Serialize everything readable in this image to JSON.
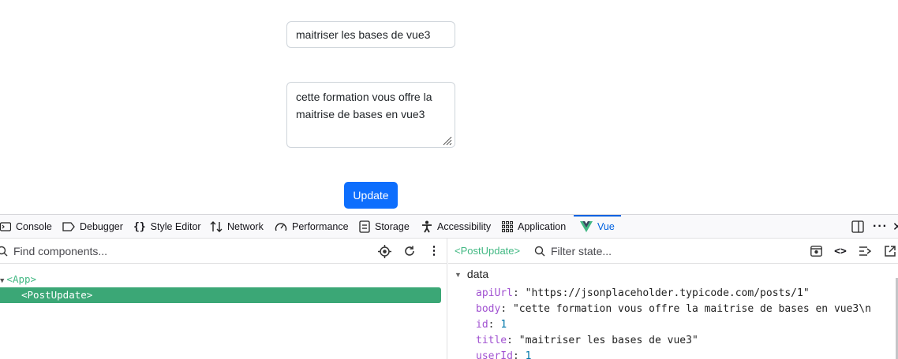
{
  "form": {
    "title_value": "maitriser les bases de vue3",
    "body_value": "cette formation vous offre la maitrise de bases en vue3",
    "update_label": "Update"
  },
  "devtools": {
    "tabs": [
      {
        "label": "Console",
        "icon": "console-icon"
      },
      {
        "label": "Debugger",
        "icon": "debugger-icon"
      },
      {
        "label": "Style Editor",
        "icon": "style-editor-icon"
      },
      {
        "label": "Network",
        "icon": "network-icon"
      },
      {
        "label": "Performance",
        "icon": "performance-icon"
      },
      {
        "label": "Storage",
        "icon": "storage-icon"
      },
      {
        "label": "Accessibility",
        "icon": "accessibility-icon"
      },
      {
        "label": "Application",
        "icon": "application-icon"
      },
      {
        "label": "Vue",
        "icon": "vue-logo-icon",
        "active": true
      }
    ],
    "components": {
      "search_placeholder": "Find components...",
      "tree": [
        {
          "label": "<App>",
          "expanded": true
        },
        {
          "label": "<PostUpdate>",
          "selected": true
        }
      ]
    },
    "inspector": {
      "breadcrumb": "<PostUpdate>",
      "filter_placeholder": "Filter state...",
      "section": "data",
      "props": [
        {
          "key": "apiUrl",
          "value": "\"https://jsonplaceholder.typicode.com/posts/1\"",
          "kind": "str"
        },
        {
          "key": "body",
          "value": "\"cette formation vous offre la maitrise de bases en vue3\\n",
          "kind": "str"
        },
        {
          "key": "id",
          "value": "1",
          "kind": "num"
        },
        {
          "key": "title",
          "value": "\"maitriser les bases de vue3\"",
          "kind": "str"
        },
        {
          "key": "userId",
          "value": "1",
          "kind": "num"
        }
      ]
    },
    "colors": {
      "vue_green": "#42b883",
      "selected_row": "#3ba776",
      "active_tab": "#0061e0",
      "button_blue": "#0d6efd"
    }
  }
}
